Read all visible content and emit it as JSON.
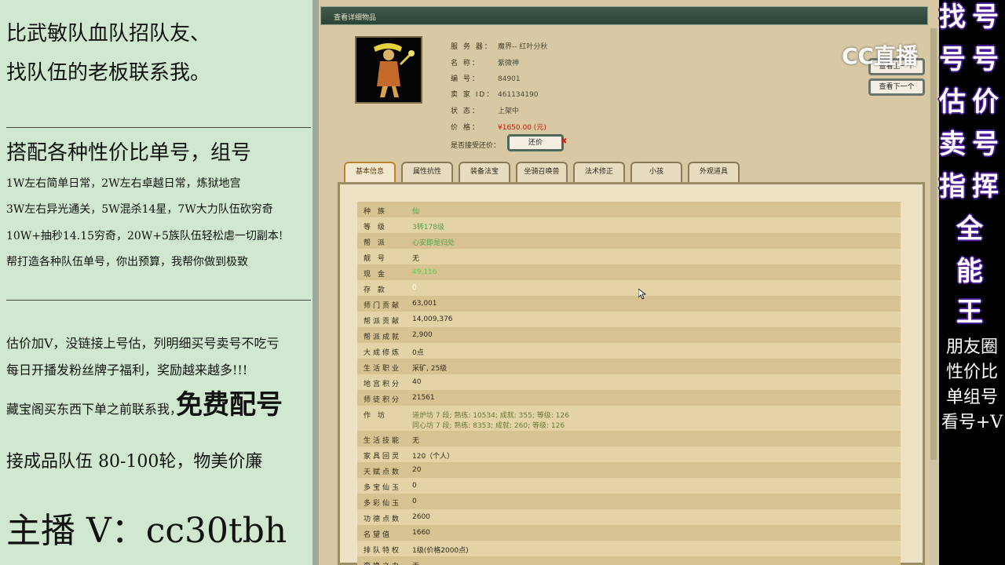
{
  "left_panel": {
    "line1": "比武敏队血队招队友、",
    "line2": "找队伍的老板联系我。",
    "heading2": "搭配各种性价比单号，组号",
    "sub1": "1W左右简单日常，2W左右卓越日常，炼狱地宫",
    "sub2": "3W左右异光通关，5W混杀14星，7W大力队伍砍穷奇",
    "sub3": "10W+抽秒14.15穷奇，20W+5族队伍轻松虐一切副本!",
    "sub4": "帮打造各种队伍单号，你出预算，我帮你做到极致",
    "line3": "估价加V，没链接上号估，列明细买号卖号不吃亏",
    "line4": "每日开播发粉丝牌子福利，奖励越来越多!!!",
    "line5": "藏宝阁买东西下单之前联系我，",
    "free": "免费配号",
    "line6": "接成品队伍 80-100轮，物美价廉",
    "host": "主播 V：cc30tbh"
  },
  "window": {
    "title": "查看详细物品",
    "info": {
      "server_key": "服 务 器：",
      "server_val": "魔界-- 红叶分秋",
      "name_key": "名 称：",
      "name_val": "紫微神",
      "id_key": "编 号：",
      "id_val": "84901",
      "seller_key": "卖 家 ID：",
      "seller_val": "461134190",
      "status_key": "状 态：",
      "status_val": "上架中",
      "price_key": "价 格：",
      "price_val": "¥1650.00 (元)",
      "counter_label": "是否接受还价：",
      "counter_btn": "还价",
      "close": "✖"
    },
    "nav_prev": "查看上一个",
    "nav_next": "查看下一个",
    "tabs": [
      "基本信息",
      "属性抗性",
      "装备法宝",
      "坐骑召唤兽",
      "法术修正",
      "小孩",
      "外观道具"
    ],
    "rows": [
      {
        "key": "种 族",
        "val": "仙"
      },
      {
        "key": "等 级",
        "val": "3转178级"
      },
      {
        "key": "帮 派",
        "val": "心安即是归处"
      },
      {
        "key": "靓 号",
        "val": "无"
      },
      {
        "key": "现 金",
        "val": "49,116"
      },
      {
        "key": "存 款",
        "val": "0"
      },
      {
        "key": "师门贡献",
        "val": "63,001"
      },
      {
        "key": "帮派贡献",
        "val": "14,009,376"
      },
      {
        "key": "帮派成就",
        "val": "2,900"
      },
      {
        "key": "大成修炼",
        "val": "0点"
      },
      {
        "key": "生活职业",
        "val": "采矿, 25级"
      },
      {
        "key": "地宫积分",
        "val": "40"
      },
      {
        "key": "师徒积分",
        "val": "21561"
      },
      {
        "key": "作 坊",
        "val": "道炉坊 7 段; 熟练: 10534; 成就: 355; 等级: 126",
        "val2": "同心坊 7 段; 熟练: 8353; 成就: 260; 等级: 126"
      },
      {
        "key": "生活技能",
        "val": "无"
      },
      {
        "key": "家具回灵",
        "val": "120（个人）"
      },
      {
        "key": "天赋点数",
        "val": "20"
      },
      {
        "key": "多宝仙玉",
        "val": "0"
      },
      {
        "key": "多彩仙玉",
        "val": "0"
      },
      {
        "key": "功德点数",
        "val": "2600"
      },
      {
        "key": "名望值",
        "val": "1660"
      },
      {
        "key": "排队特权",
        "val": "1级(价格2000点)"
      },
      {
        "key": "变换之力",
        "val": "无"
      }
    ]
  },
  "watermark": "CC直播",
  "right_panel": {
    "col1": [
      "找",
      "号",
      "估",
      "卖",
      "指"
    ],
    "col2": [
      "号",
      "号",
      "价",
      "号",
      "挥"
    ],
    "single": [
      "全",
      "能",
      "王"
    ],
    "small": [
      "朋友圈",
      "性价比",
      "单组号",
      "看号+V"
    ]
  },
  "colors": {
    "left_bg": "#cfe8cf",
    "window_bg": "#d8c9a4",
    "price": "#c21c0c",
    "right_outline": "#4b1b9a"
  }
}
